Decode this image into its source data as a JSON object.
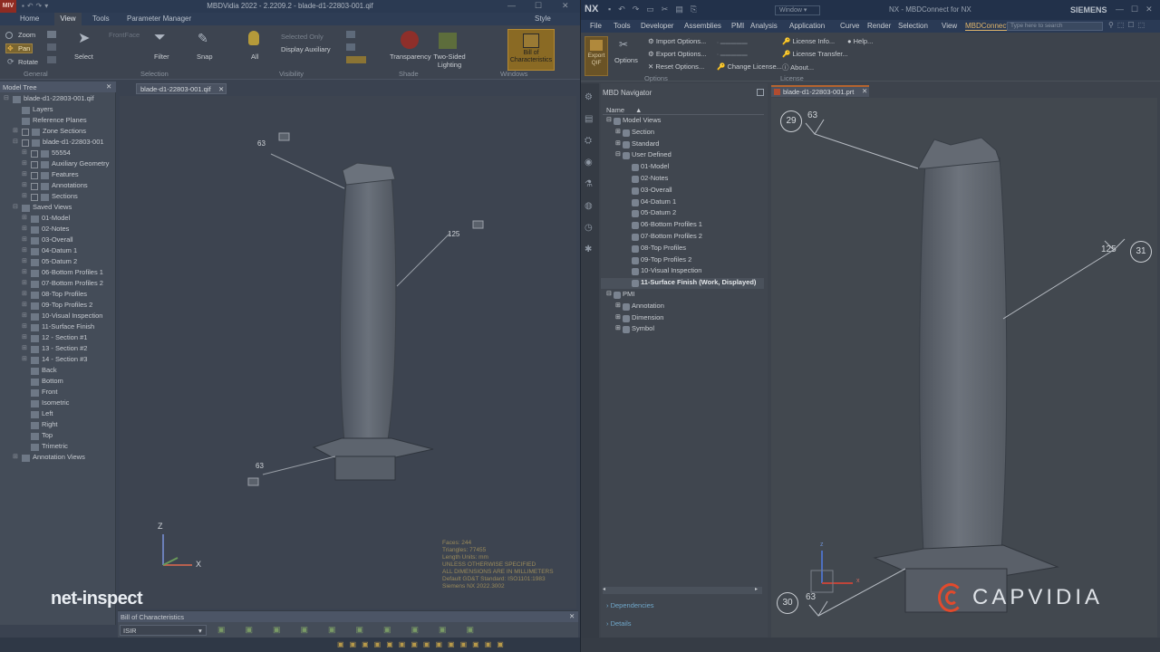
{
  "left_app": {
    "logo": "MIV",
    "title": "MBDVidia 2022 - 2.2209.2 - blade-d1-22803-001.qif",
    "menu_tabs": [
      "Home",
      "View",
      "Tools",
      "Parameter Manager"
    ],
    "style_label": "Style",
    "ribbon": {
      "zoom": "Zoom",
      "pan": "Pan",
      "rotate": "Rotate",
      "frontface": "FrontFace",
      "select": "Select",
      "filter": "Filter",
      "snap": "Snap",
      "all": "All",
      "selected_only": "Selected Only",
      "display_auxiliary": "Display Auxiliary",
      "transparency": "Transparency",
      "two_sided_lighting": "Two-Sided Lighting",
      "bill_of_characteristics": "Bill of Characteristics",
      "groups": [
        "General",
        "Selection",
        "Visibility",
        "Shade",
        "Windows"
      ]
    },
    "model_tree": {
      "title": "Model Tree",
      "rows": [
        {
          "text": "blade-d1-22803-001.qif",
          "level": 0,
          "toggle": "⊟",
          "box": false
        },
        {
          "text": "Layers",
          "level": 1,
          "toggle": "",
          "box": false
        },
        {
          "text": "Reference Planes",
          "level": 1,
          "toggle": "",
          "box": false
        },
        {
          "text": "Zone Sections",
          "level": 1,
          "toggle": "⊞",
          "box": true
        },
        {
          "text": "blade-d1-22803-001",
          "level": 1,
          "toggle": "⊟",
          "box": true
        },
        {
          "text": "55554",
          "level": 2,
          "toggle": "⊞",
          "box": true
        },
        {
          "text": "Auxiliary Geometry",
          "level": 2,
          "toggle": "⊞",
          "box": true
        },
        {
          "text": "Features",
          "level": 2,
          "toggle": "⊞",
          "box": true
        },
        {
          "text": "Annotations",
          "level": 2,
          "toggle": "⊞",
          "box": true
        },
        {
          "text": "Sections",
          "level": 2,
          "toggle": "⊞",
          "box": true
        },
        {
          "text": "Saved Views",
          "level": 1,
          "toggle": "⊟",
          "box": false
        },
        {
          "text": "01-Model",
          "level": 2,
          "toggle": "⊞",
          "box": false
        },
        {
          "text": "02-Notes",
          "level": 2,
          "toggle": "⊞",
          "box": false
        },
        {
          "text": "03-Overall",
          "level": 2,
          "toggle": "⊞",
          "box": false
        },
        {
          "text": "04-Datum 1",
          "level": 2,
          "toggle": "⊞",
          "box": false
        },
        {
          "text": "05-Datum 2",
          "level": 2,
          "toggle": "⊞",
          "box": false
        },
        {
          "text": "06-Bottom Profiles 1",
          "level": 2,
          "toggle": "⊞",
          "box": false
        },
        {
          "text": "07-Bottom Profiles 2",
          "level": 2,
          "toggle": "⊞",
          "box": false
        },
        {
          "text": "08-Top Profiles",
          "level": 2,
          "toggle": "⊞",
          "box": false
        },
        {
          "text": "09-Top Profiles 2",
          "level": 2,
          "toggle": "⊞",
          "box": false
        },
        {
          "text": "10-Visual Inspection",
          "level": 2,
          "toggle": "⊞",
          "box": false
        },
        {
          "text": "11-Surface Finish",
          "level": 2,
          "toggle": "⊞",
          "box": false
        },
        {
          "text": "12 - Section #1",
          "level": 2,
          "toggle": "⊞",
          "box": false
        },
        {
          "text": "13 - Section #2",
          "level": 2,
          "toggle": "⊞",
          "box": false
        },
        {
          "text": "14 - Section #3",
          "level": 2,
          "toggle": "⊞",
          "box": false
        },
        {
          "text": "Back",
          "level": 2,
          "toggle": "",
          "box": false
        },
        {
          "text": "Bottom",
          "level": 2,
          "toggle": "",
          "box": false
        },
        {
          "text": "Front",
          "level": 2,
          "toggle": "",
          "box": false
        },
        {
          "text": "Isometric",
          "level": 2,
          "toggle": "",
          "box": false
        },
        {
          "text": "Left",
          "level": 2,
          "toggle": "",
          "box": false
        },
        {
          "text": "Right",
          "level": 2,
          "toggle": "",
          "box": false
        },
        {
          "text": "Top",
          "level": 2,
          "toggle": "",
          "box": false
        },
        {
          "text": "Trimetric",
          "level": 2,
          "toggle": "",
          "box": false
        },
        {
          "text": "Annotation Views",
          "level": 1,
          "toggle": "⊞",
          "box": false
        }
      ]
    },
    "doc_tab": "blade-d1-22803-001.qif",
    "viewport": {
      "annotations": [
        "63",
        "125",
        "63"
      ],
      "axis_z": "Z",
      "axis_x": "X",
      "info_lines": [
        "Faces: 244",
        "Triangles: 77455",
        "Length Units: mm",
        "UNLESS OTHERWISE SPECIFIED",
        "ALL DIMENSIONS ARE IN MILLIMETERS",
        "Default GD&T Standard: ISO1101:1983",
        "Siemens NX 2022.3002"
      ]
    },
    "boc_title": "Bill of Characteristics",
    "boc_combo": "ISIR",
    "watermark": "net-inspect"
  },
  "right_app": {
    "logo": "NX",
    "window_menu": "Window",
    "title": "NX - MBDConnect for NX",
    "brand": "SIEMENS",
    "menu_tabs": [
      "File",
      "Tools",
      "Developer",
      "Assemblies",
      "PMI",
      "Analysis",
      "Application",
      "Curve",
      "Render",
      "Selection",
      "View",
      "MBDConnect"
    ],
    "search_placeholder": "Type here to search",
    "ribbon": {
      "export_qif": "Export QIF",
      "options": "Options",
      "import_options": "Import Options...",
      "export_options": "Export Options...",
      "reset_options": "Reset Options...",
      "license_info": "License Info...",
      "license_transfer": "License Transfer...",
      "change_license": "Change License...",
      "about": "About...",
      "help": "Help...",
      "group_options": "Options",
      "group_license": "License"
    },
    "navigator": {
      "title": "MBD Navigator",
      "column": "Name",
      "rows": [
        {
          "text": "Model Views",
          "level": 0,
          "toggle": "⊟",
          "bold": false
        },
        {
          "text": "Section",
          "level": 1,
          "toggle": "⊞",
          "bold": false
        },
        {
          "text": "Standard",
          "level": 1,
          "toggle": "⊞",
          "bold": false
        },
        {
          "text": "User Defined",
          "level": 1,
          "toggle": "⊟",
          "bold": false
        },
        {
          "text": "01-Model",
          "level": 2,
          "toggle": "",
          "bold": false
        },
        {
          "text": "02-Notes",
          "level": 2,
          "toggle": "",
          "bold": false
        },
        {
          "text": "03-Overall",
          "level": 2,
          "toggle": "",
          "bold": false
        },
        {
          "text": "04-Datum 1",
          "level": 2,
          "toggle": "",
          "bold": false
        },
        {
          "text": "05-Datum 2",
          "level": 2,
          "toggle": "",
          "bold": false
        },
        {
          "text": "06-Bottom Profiles 1",
          "level": 2,
          "toggle": "",
          "bold": false
        },
        {
          "text": "07-Bottom Profiles 2",
          "level": 2,
          "toggle": "",
          "bold": false
        },
        {
          "text": "08-Top Profiles",
          "level": 2,
          "toggle": "",
          "bold": false
        },
        {
          "text": "09-Top Profiles 2",
          "level": 2,
          "toggle": "",
          "bold": false
        },
        {
          "text": "10-Visual Inspection",
          "level": 2,
          "toggle": "",
          "bold": false
        },
        {
          "text": "11-Surface Finish (Work, Displayed)",
          "level": 2,
          "toggle": "",
          "bold": true
        },
        {
          "text": "PMI",
          "level": 0,
          "toggle": "⊟",
          "bold": false
        },
        {
          "text": "Annotation",
          "level": 1,
          "toggle": "⊞",
          "bold": false
        },
        {
          "text": "Dimension",
          "level": 1,
          "toggle": "⊞",
          "bold": false
        },
        {
          "text": "Symbol",
          "level": 1,
          "toggle": "⊞",
          "bold": false
        }
      ],
      "dependencies": "Dependencies",
      "details": "Details"
    },
    "doc_tab": "blade-d1-22803-001.prt",
    "viewport": {
      "bubbles": [
        "29",
        "31",
        "30"
      ],
      "surface_values": [
        "63",
        "125",
        "63"
      ],
      "axis_z": "z",
      "axis_x": "x"
    },
    "watermark": "CAPVIDIA"
  }
}
